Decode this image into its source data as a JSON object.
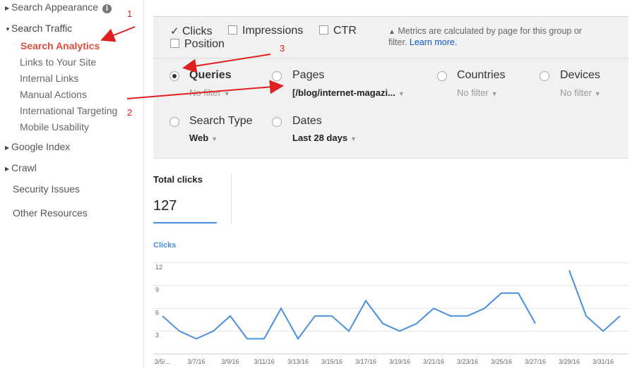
{
  "sidebar": {
    "items": [
      {
        "label": "Search Appearance"
      },
      {
        "label": "Search Traffic"
      },
      {
        "label": "Search Analytics"
      },
      {
        "label": "Links to Your Site"
      },
      {
        "label": "Internal Links"
      },
      {
        "label": "Manual Actions"
      },
      {
        "label": "International Targeting"
      },
      {
        "label": "Mobile Usability"
      },
      {
        "label": "Google Index"
      },
      {
        "label": "Crawl"
      },
      {
        "label": "Security Issues"
      },
      {
        "label": "Other Resources"
      }
    ],
    "info_icon": "i"
  },
  "metrics": {
    "clicks": "Clicks",
    "impressions": "Impressions",
    "ctr": "CTR",
    "position": "Position",
    "note_text": "Metrics are calculated by page for this group or filter.",
    "note_link": "Learn more."
  },
  "groups": {
    "queries": {
      "title": "Queries",
      "sub": "No filter"
    },
    "pages": {
      "title": "Pages",
      "sub": "[/blog/internet-magazi..."
    },
    "countries": {
      "title": "Countries",
      "sub": "No filter"
    },
    "devices": {
      "title": "Devices",
      "sub": "No filter"
    },
    "search_type": {
      "title": "Search Type",
      "sub": "Web"
    },
    "dates": {
      "title": "Dates",
      "sub": "Last 28 days"
    }
  },
  "stats": {
    "total_label": "Total clicks",
    "total_value": "127"
  },
  "annotations": [
    "1",
    "2",
    "3"
  ],
  "colors": {
    "line": "#4a8fdf",
    "active": "#dd4b39",
    "arrow": "#e02020"
  },
  "chart_data": {
    "type": "line",
    "title": "Clicks",
    "ylim": [
      0,
      13
    ],
    "yticks": [
      3,
      6,
      9,
      12
    ],
    "x": [
      "3/5/...",
      "3/6/16",
      "3/7/16",
      "3/8/16",
      "3/9/16",
      "3/10/16",
      "3/11/16",
      "3/12/16",
      "3/13/16",
      "3/14/16",
      "3/15/16",
      "3/16/16",
      "3/17/16",
      "3/18/16",
      "3/19/16",
      "3/20/16",
      "3/21/16",
      "3/22/16",
      "3/23/16",
      "3/24/16",
      "3/25/16",
      "3/26/16",
      "3/27/16",
      "3/28/16",
      "3/29/16",
      "3/30/16",
      "3/31/16",
      "4/1/16"
    ],
    "xtick_labels": [
      "3/5/...",
      "3/7/16",
      "3/9/16",
      "3/11/16",
      "3/13/16",
      "3/15/16",
      "3/17/16",
      "3/19/16",
      "3/21/16",
      "3/23/16",
      "3/25/16",
      "3/27/16",
      "3/29/16",
      "3/31/16"
    ],
    "series": [
      {
        "values": [
          5,
          3,
          2,
          3,
          5,
          2,
          2,
          6,
          2,
          5,
          5,
          3,
          7,
          4,
          3,
          4,
          6,
          5,
          5,
          6,
          8,
          8,
          4,
          null,
          11,
          5,
          3,
          5
        ]
      }
    ],
    "grid": true
  }
}
